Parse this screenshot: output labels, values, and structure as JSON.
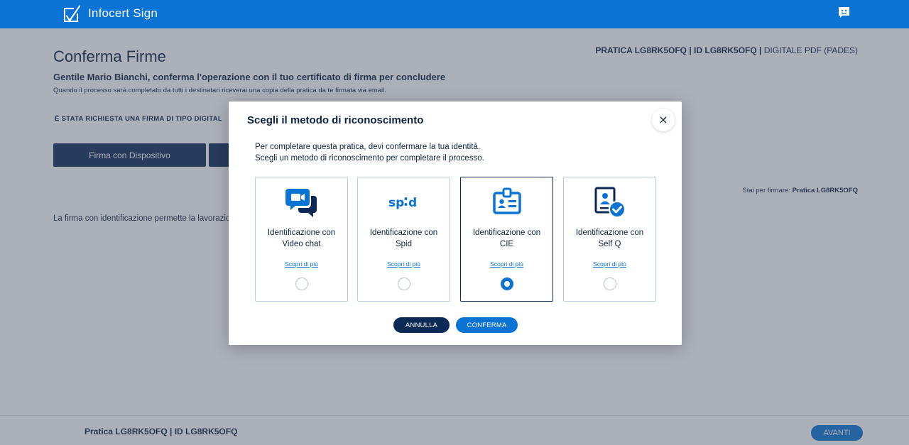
{
  "header": {
    "brand": "Infocert Sign",
    "color": "#0a73d4"
  },
  "page": {
    "title": "Conferma Firme",
    "pratica_bold": "PRATICA LG8RK5OFQ | ID LG8RK5OFQ |",
    "pratica_type": " DIGITALE PDF (PADES)",
    "greeting": "Gentile Mario Bianchi, conferma l'operazione con il tuo certificato di firma per concludere",
    "subline": "Quando il processo sarà completato da tutti i destinatari riceverai una copia della pratica da te firmata via email.",
    "request_note": "È STATA RICHIESTA UNA FIRMA DI TIPO DIGITALE PDF",
    "device_button": "Firma con Dispositivo",
    "signing_prefix": "Stai per firmare: ",
    "signing_value": "Pratica LG8RK5OFQ",
    "info_line": "La firma con identificazione permette la lavorazione"
  },
  "footer": {
    "pratica": "Pratica LG8RK5OFQ | ID LG8RK5OFQ",
    "avanti": "AVANTI"
  },
  "modal": {
    "title": "Scegli il metodo di riconoscimento",
    "close": "×",
    "text1": "Per completare questa pratica, devi confermare la tua identità.",
    "text2": "Scegli un metodo di riconoscimento per completare il processo.",
    "cards": [
      {
        "label": "Identificazione con Video chat",
        "link": "Scopri di più",
        "icon": "video-chat-icon",
        "selected": false
      },
      {
        "label": "Identificazione con Spid",
        "link": "Scopri di più",
        "icon": "spid-icon",
        "selected": false
      },
      {
        "label": "Identificazione con CIE",
        "link": "Scopri di più",
        "icon": "id-card-icon",
        "selected": true
      },
      {
        "label": "Identificazione con Self Q",
        "link": "Scopri di più",
        "icon": "document-check-icon",
        "selected": false
      }
    ],
    "cancel": "ANNULLA",
    "confirm": "CONFERMA"
  },
  "colors": {
    "primary": "#0a73d4",
    "dark": "#0d2a56",
    "text": "#0d2240"
  }
}
